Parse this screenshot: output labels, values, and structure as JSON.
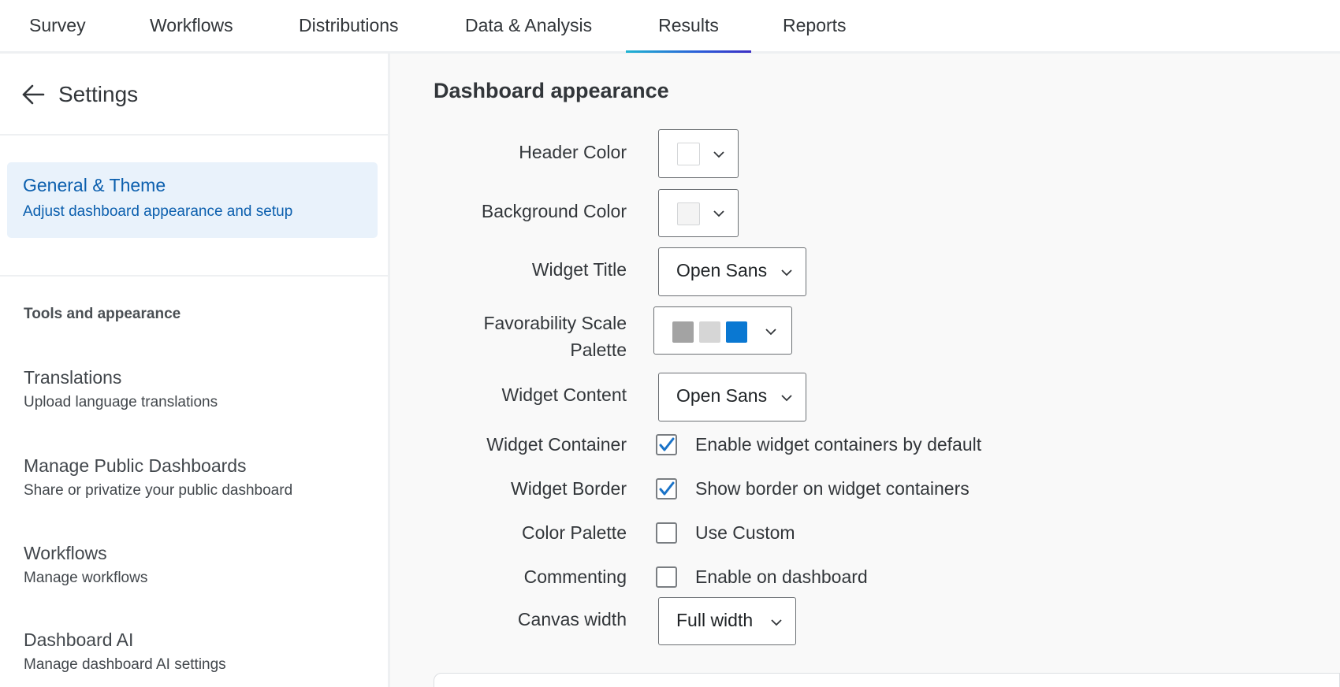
{
  "nav": {
    "tabs": [
      {
        "label": "Survey"
      },
      {
        "label": "Workflows"
      },
      {
        "label": "Distributions"
      },
      {
        "label": "Data & Analysis"
      },
      {
        "label": "Results"
      },
      {
        "label": "Reports"
      }
    ],
    "active_tab": "Results"
  },
  "sidebar": {
    "title": "Settings",
    "selected": {
      "title": "General & Theme",
      "subtitle": "Adjust dashboard appearance and setup"
    },
    "section_heading": "Tools and appearance",
    "items": [
      {
        "title": "Translations",
        "subtitle": "Upload language translations"
      },
      {
        "title": "Manage Public Dashboards",
        "subtitle": "Share or privatize your public dashboard"
      },
      {
        "title": "Workflows",
        "subtitle": "Manage workflows"
      },
      {
        "title": "Dashboard AI",
        "subtitle": "Manage dashboard AI settings"
      }
    ]
  },
  "main": {
    "title": "Dashboard appearance",
    "header_color": {
      "label": "Header Color",
      "swatch": "#ffffff"
    },
    "background_color": {
      "label": "Background Color",
      "swatch": "#f4f4f4"
    },
    "widget_title": {
      "label": "Widget Title",
      "value": "Open Sans"
    },
    "favorability": {
      "label_line1": "Favorability Scale",
      "label_line2": "Palette",
      "colors": [
        "#a3a3a3",
        "#d6d6d6",
        "#0a78d2"
      ]
    },
    "widget_content": {
      "label": "Widget Content",
      "value": "Open Sans"
    },
    "widget_container": {
      "label": "Widget Container",
      "checkbox_label": "Enable widget containers by default",
      "checked": true
    },
    "widget_border": {
      "label": "Widget Border",
      "checkbox_label": "Show border on widget containers",
      "checked": true
    },
    "color_palette": {
      "label": "Color Palette",
      "checkbox_label": "Use Custom",
      "checked": false
    },
    "commenting": {
      "label": "Commenting",
      "checkbox_label": "Enable on dashboard",
      "checked": false
    },
    "canvas_width": {
      "label": "Canvas width",
      "value": "Full width"
    }
  },
  "colors": {
    "accent_blue": "#0b5fae",
    "checkbox_check": "#1a73c8",
    "selected_bg": "#e9f2fb"
  }
}
